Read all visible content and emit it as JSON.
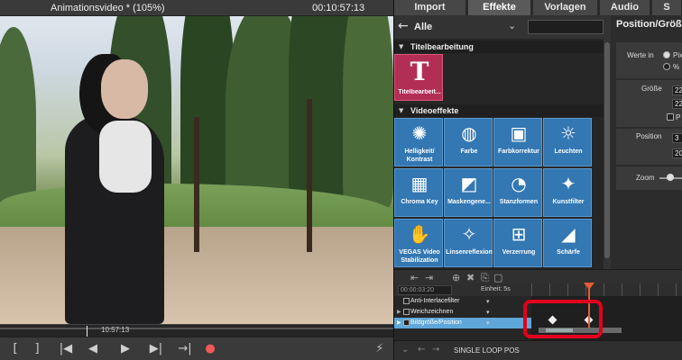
{
  "preview": {
    "title": "Animationsvideo * (105%)",
    "timecode": "00:10:57:13",
    "scrub_timecode": "10:57:13"
  },
  "transport": {
    "mark_in": "[",
    "mark_out": "]",
    "prev_marker": "|◀",
    "prev_frame": "◀",
    "play": "▶",
    "next_marker": "▶|",
    "to_end": "→|",
    "record": "●",
    "extra": "⚡"
  },
  "tabs": [
    "Import",
    "Effekte",
    "Vorlagen",
    "Audio",
    "S"
  ],
  "active_tab": "Effekte",
  "effects": {
    "filter_label": "Alle",
    "sections": {
      "title": "Titelbearbeitung",
      "video": "Videoeffekte"
    },
    "title_tile": {
      "icon": "T",
      "label": "Titelbearbeit..."
    },
    "tiles": [
      {
        "label": "Helligkeit/ Kontrast",
        "icon": "✺"
      },
      {
        "label": "Farbe",
        "icon": "◍"
      },
      {
        "label": "Farbkorrektur",
        "icon": "▣"
      },
      {
        "label": "Leuchten",
        "icon": "☼"
      },
      {
        "label": "Chroma Key",
        "icon": "▦"
      },
      {
        "label": "Maskengene...",
        "icon": "◩"
      },
      {
        "label": "Stanzformen",
        "icon": "◔"
      },
      {
        "label": "Kunstfilter",
        "icon": "✦"
      },
      {
        "label": "VEGAS Video Stabilization",
        "icon": "✋"
      },
      {
        "label": "Linsenreflexion",
        "icon": "✧"
      },
      {
        "label": "Verzerrung",
        "icon": "⊞"
      },
      {
        "label": "Schärfe",
        "icon": "◢"
      }
    ]
  },
  "properties": {
    "header": "Position/Größe",
    "werte_in": "Werte in",
    "opt_pixel": "Pix",
    "opt_percent": "%",
    "groesse": "Größe",
    "size_w": "22",
    "size_h": "22",
    "proportional": "P",
    "position": "Position",
    "pos_x": "3",
    "pos_y": "20",
    "zoom": "Zoom"
  },
  "timeline": {
    "timecode": "00:00:03:20",
    "unit_label": "Einheit: 5s",
    "tracks": [
      {
        "label": "Anti-Interlacefilter"
      },
      {
        "label": "Weichzeichnen"
      },
      {
        "label": "Bildgröße/Position"
      }
    ]
  },
  "status": {
    "text": "SINGLE LOOP POS"
  }
}
